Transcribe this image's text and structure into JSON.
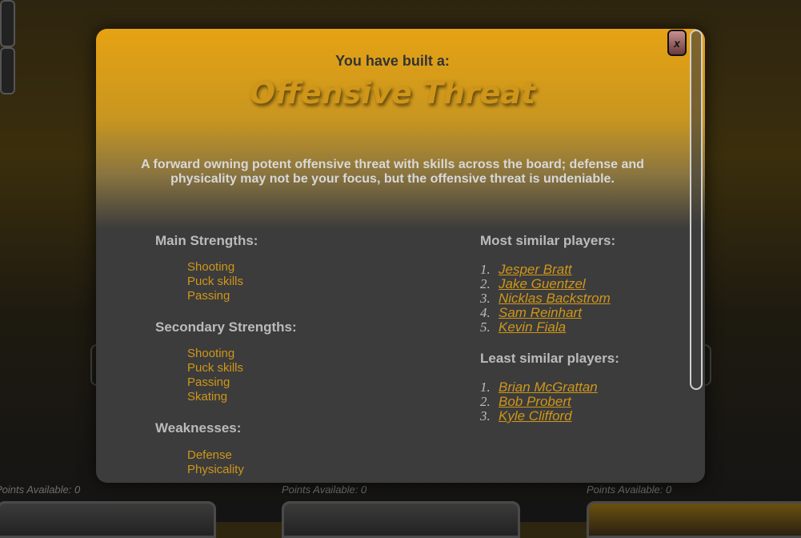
{
  "background": {
    "points_available": [
      "Points Available: 0",
      "Points Available: 0",
      "Points Available: 0"
    ]
  },
  "modal": {
    "close_label": "x",
    "subtitle": "You have built a:",
    "title": "Offensive Threat",
    "description": "A forward owning potent offensive threat with skills across the board; defense and physicality may not be your focus, but the offensive threat is undeniable.",
    "main_strengths": {
      "heading": "Main Strengths:",
      "items": [
        "Shooting",
        "Puck skills",
        "Passing"
      ]
    },
    "secondary_strengths": {
      "heading": "Secondary Strengths:",
      "items": [
        "Shooting",
        "Puck skills",
        "Passing",
        "Skating"
      ]
    },
    "weaknesses": {
      "heading": "Weaknesses:",
      "items": [
        "Defense",
        "Physicality"
      ]
    },
    "most_similar": {
      "heading": "Most similar players:",
      "players": [
        {
          "num": "1.",
          "name": "Jesper Bratt"
        },
        {
          "num": "2.",
          "name": "Jake Guentzel"
        },
        {
          "num": "3.",
          "name": "Nicklas Backstrom"
        },
        {
          "num": "4.",
          "name": "Sam Reinhart"
        },
        {
          "num": "5.",
          "name": "Kevin Fiala"
        }
      ]
    },
    "least_similar": {
      "heading": "Least similar players:",
      "players": [
        {
          "num": "1.",
          "name": "Brian McGrattan"
        },
        {
          "num": "2.",
          "name": "Bob Probert"
        },
        {
          "num": "3.",
          "name": "Kyle Clifford"
        }
      ]
    }
  },
  "colors": {
    "accent_gold": "#cf9619",
    "modal_dark": "#3c3c3c",
    "heading_gray": "#bbbbbb"
  }
}
